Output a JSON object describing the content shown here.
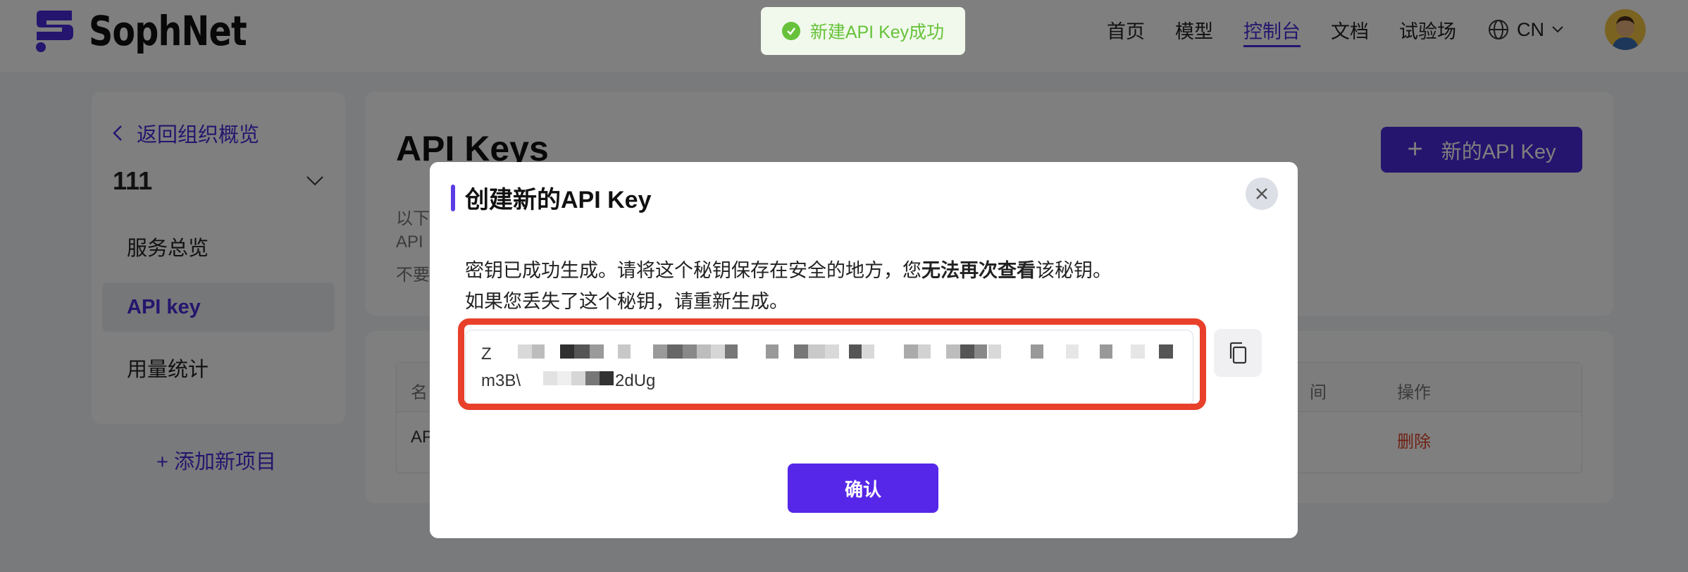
{
  "header": {
    "brand": "SophNet",
    "nav": [
      "首页",
      "模型",
      "控制台",
      "文档",
      "试验场"
    ],
    "active_nav": "控制台",
    "language": "CN"
  },
  "toast": {
    "message": "新建API Key成功",
    "icon": "check-circle-icon",
    "color": "#67c23a"
  },
  "sidebar": {
    "back_label": "返回组织概览",
    "org_name": "111",
    "items": [
      {
        "label": "服务总览",
        "active": false
      },
      {
        "label": "API key",
        "active": true
      },
      {
        "label": "用量统计",
        "active": false
      }
    ],
    "add_project": "+ 添加新项目"
  },
  "main": {
    "title": "API Keys",
    "new_key_label": "新的API Key",
    "desc_fragments": [
      "以下",
      "API",
      "不要"
    ],
    "table": {
      "header_fragments": [
        "名",
        "间",
        "操作"
      ],
      "row_fragment": "AP",
      "delete_label": "删除"
    }
  },
  "modal": {
    "title": "创建新的API Key",
    "line1_before": "密钥已成功生成。请将这个秘钥保存在安全的地方，您",
    "line1_bold": "无法再次查看",
    "line1_after": "该秘钥。",
    "line2": "如果您丢失了这个秘钥，请重新生成。",
    "key_line1_start": "Z",
    "key_line2_start": "m3B\\",
    "key_line2_end": "2dUg",
    "confirm_label": "确认"
  },
  "colors": {
    "accent": "#4b2bdc",
    "highlight": "#e8402a",
    "danger": "#e0452a"
  }
}
